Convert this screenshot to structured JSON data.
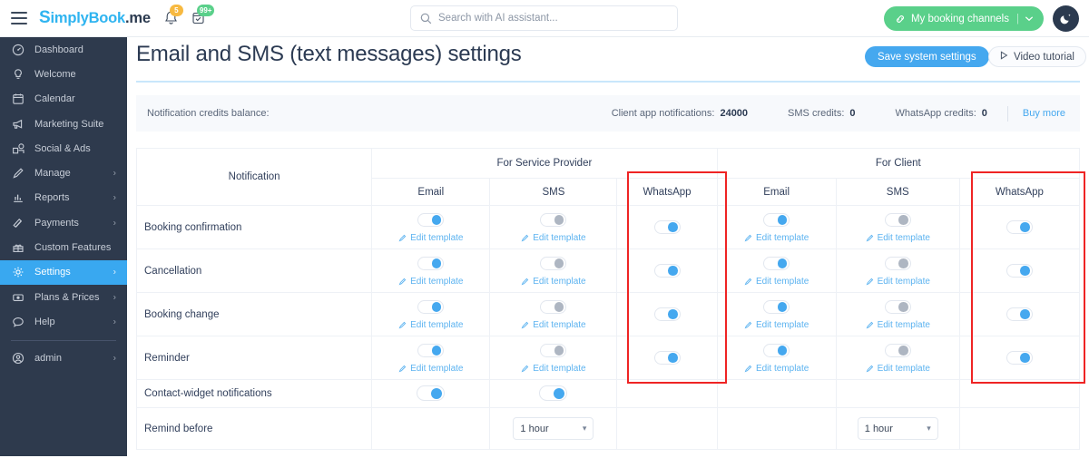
{
  "topbar": {
    "menu_icon": "hamburger-icon",
    "brand": {
      "first": "S",
      "mid": "implyBook",
      "suffix": ".me"
    },
    "bell_icon": "bell-icon",
    "bell_badge": "5",
    "calendar_icon": "calendar-check-icon",
    "calendar_badge": "99+",
    "search": {
      "placeholder": "Search with AI assistant...",
      "value": "",
      "icon": "search-icon"
    },
    "booking_button": {
      "label": "My booking channels",
      "icon": "link-icon",
      "chevron": "chevron-down-icon",
      "color": "#5ad08a"
    },
    "theme_toggle": {
      "icon": "moon-icon",
      "color": "#2b3a4f"
    }
  },
  "sidebar": {
    "items": [
      {
        "label": "Dashboard",
        "icon": "speedometer-icon",
        "arrow": false,
        "active": false
      },
      {
        "label": "Welcome",
        "icon": "lightbulb-icon",
        "arrow": false,
        "active": false
      },
      {
        "label": "Calendar",
        "icon": "calendar-icon",
        "arrow": false,
        "active": false
      },
      {
        "label": "Marketing Suite",
        "icon": "megaphone-icon",
        "arrow": false,
        "active": false
      },
      {
        "label": "Social & Ads",
        "icon": "social-ads-icon",
        "arrow": false,
        "active": false
      },
      {
        "label": "Manage",
        "icon": "pencil-icon",
        "arrow": true,
        "active": false
      },
      {
        "label": "Reports",
        "icon": "bar-chart-icon",
        "arrow": true,
        "active": false
      },
      {
        "label": "Payments",
        "icon": "banknotes-icon",
        "arrow": true,
        "active": false
      },
      {
        "label": "Custom Features",
        "icon": "gift-icon",
        "arrow": false,
        "active": false
      },
      {
        "label": "Settings",
        "icon": "gear-icon",
        "arrow": true,
        "active": true
      },
      {
        "label": "Plans & Prices",
        "icon": "card-icon",
        "arrow": true,
        "active": false
      },
      {
        "label": "Help",
        "icon": "chat-icon",
        "arrow": true,
        "active": false
      }
    ],
    "account": {
      "label": "admin",
      "icon": "user-circle-icon",
      "arrow": true
    },
    "active_color": "#39a8f0",
    "background": "#2e3a4d"
  },
  "header": {
    "title": "Email and SMS (text messages) settings",
    "save_label": "Save system settings",
    "tutorial_label": "Video tutorial",
    "tutorial_icon": "play-icon"
  },
  "credits": {
    "label": "Notification credits balance:",
    "items": [
      {
        "label": "Client app notifications:",
        "value": "24000"
      },
      {
        "label": "SMS credits:",
        "value": "0"
      },
      {
        "label": "WhatsApp credits:",
        "value": "0"
      }
    ],
    "buy_more": "Buy more"
  },
  "table": {
    "notification_header": "Notification",
    "groups": [
      {
        "label": "For Service Provider"
      },
      {
        "label": "For Client"
      }
    ],
    "channels": [
      "Email",
      "SMS",
      "WhatsApp"
    ],
    "edit_template_label": "Edit template",
    "edit_template_icon": "pencil-icon",
    "rows": [
      {
        "label": "Booking confirmation",
        "provider": [
          {
            "toggle": "on",
            "edit": true
          },
          {
            "toggle": "off",
            "edit": true
          },
          {
            "toggle": "on",
            "edit": false
          }
        ],
        "client": [
          {
            "toggle": "on",
            "edit": true
          },
          {
            "toggle": "off",
            "edit": true
          },
          {
            "toggle": "on",
            "edit": false
          }
        ]
      },
      {
        "label": "Cancellation",
        "provider": [
          {
            "toggle": "on",
            "edit": true
          },
          {
            "toggle": "off",
            "edit": true
          },
          {
            "toggle": "on",
            "edit": false
          }
        ],
        "client": [
          {
            "toggle": "on",
            "edit": true
          },
          {
            "toggle": "off",
            "edit": true
          },
          {
            "toggle": "on",
            "edit": false
          }
        ]
      },
      {
        "label": "Booking change",
        "provider": [
          {
            "toggle": "on",
            "edit": true
          },
          {
            "toggle": "off",
            "edit": true
          },
          {
            "toggle": "on",
            "edit": false
          }
        ],
        "client": [
          {
            "toggle": "on",
            "edit": true
          },
          {
            "toggle": "off",
            "edit": true
          },
          {
            "toggle": "on",
            "edit": false
          }
        ]
      },
      {
        "label": "Reminder",
        "provider": [
          {
            "toggle": "on",
            "edit": true
          },
          {
            "toggle": "off",
            "edit": true
          },
          {
            "toggle": "on",
            "edit": false
          }
        ],
        "client": [
          {
            "toggle": "on",
            "edit": true
          },
          {
            "toggle": "off",
            "edit": true
          },
          {
            "toggle": "on",
            "edit": false
          }
        ]
      }
    ],
    "contact_widget_row": {
      "label": "Contact-widget notifications",
      "provider": [
        {
          "toggle": "on",
          "edit": false
        },
        {
          "toggle": "on",
          "edit": false
        },
        {
          "toggle": null,
          "edit": false
        }
      ],
      "client": [
        {
          "toggle": null,
          "edit": false
        },
        {
          "toggle": null,
          "edit": false
        },
        {
          "toggle": null,
          "edit": false
        }
      ]
    },
    "remind_before_row": {
      "label": "Remind before",
      "provider_value": "1 hour",
      "client_value": "1 hour",
      "chevron": "chevron-down-icon"
    }
  },
  "highlights": [
    {
      "name": "whatsapp-provider-highlight",
      "color": "#ef2424"
    },
    {
      "name": "whatsapp-client-highlight",
      "color": "#ef2424"
    }
  ]
}
